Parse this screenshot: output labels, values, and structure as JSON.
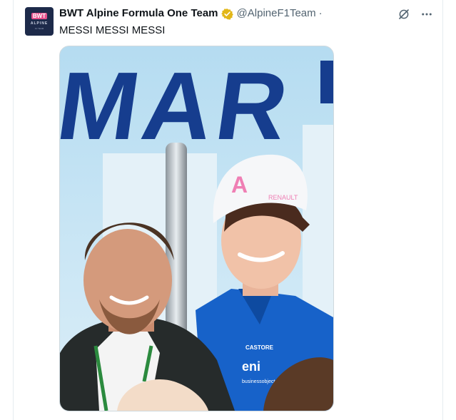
{
  "tweet": {
    "author_name": "BWT Alpine Formula One Team",
    "handle": "@AlpineF1Team",
    "separator": "·",
    "text": "MESSI MESSI MESSI",
    "verified_badge_color": "#e2b719",
    "avatar": {
      "brand_text": "BWT",
      "sub_text": "ALPINE",
      "tag_text": "F1 TEAM"
    },
    "actions": {
      "grok_icon": "grok-icon",
      "more_icon": "more-horizontal-icon"
    },
    "media": {
      "wall_lettering": "MAR",
      "cap_logo": "A",
      "cap_text": "RENAULT",
      "chest_brand": "CASTORE",
      "sponsor": "eni",
      "sponsor_sub": "businessobjects"
    }
  }
}
